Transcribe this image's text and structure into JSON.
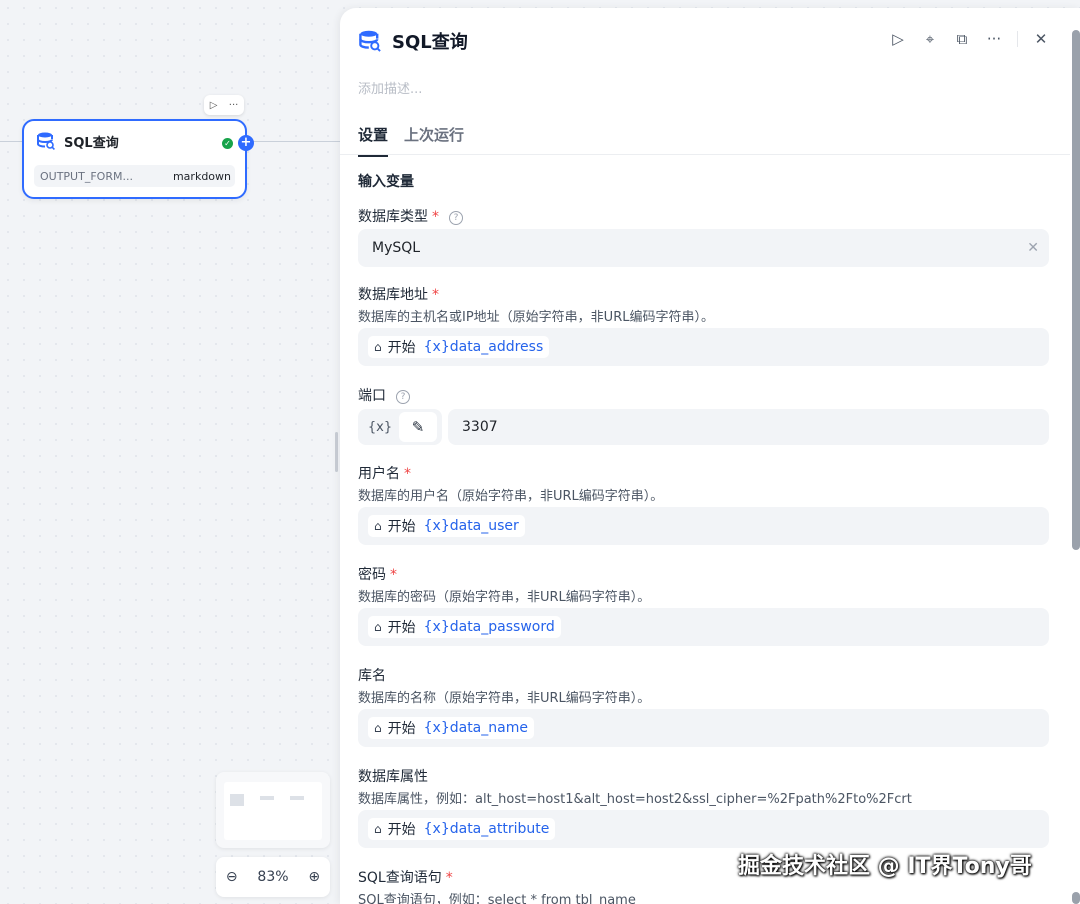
{
  "canvas": {
    "node": {
      "title": "SQL查询",
      "row_key": "OUTPUT_FORM...",
      "row_value": "markdown",
      "toolbar_run": "▷",
      "toolbar_more": "···",
      "status": "✓",
      "add": "+"
    },
    "zoom": {
      "out": "⊖",
      "level": "83%",
      "in": "⊕"
    }
  },
  "panel": {
    "title": "SQL查询",
    "actions": {
      "run": "▷",
      "locate": "⌖",
      "docs": "⧉",
      "more": "···",
      "close": "✕"
    },
    "description_placeholder": "添加描述...",
    "tabs": [
      "设置",
      "上次运行"
    ],
    "section_title": "输入变量",
    "fields": {
      "db_type": {
        "label": "数据库类型",
        "required": "*",
        "help": "?",
        "value": "MySQL",
        "clear": "✕"
      },
      "db_address": {
        "label": "数据库地址",
        "required": "*",
        "hint": "数据库的主机名或IP地址（原始字符串，非URL编码字符串）。",
        "source": "开始",
        "var": "{x}data_address"
      },
      "port": {
        "label": "端口",
        "help": "?",
        "toggle_var": "{x}",
        "toggle_edit": "✎",
        "value": "3307"
      },
      "user": {
        "label": "用户名",
        "required": "*",
        "hint": "数据库的用户名（原始字符串，非URL编码字符串）。",
        "source": "开始",
        "var": "{x}data_user"
      },
      "password": {
        "label": "密码",
        "required": "*",
        "hint": "数据库的密码（原始字符串，非URL编码字符串）。",
        "source": "开始",
        "var": "{x}data_password"
      },
      "db_name": {
        "label": "库名",
        "hint": "数据库的名称（原始字符串，非URL编码字符串）。",
        "source": "开始",
        "var": "{x}data_name"
      },
      "attributes": {
        "label": "数据库属性",
        "hint": "数据库属性，例如：alt_host=host1&alt_host=host2&ssl_cipher=%2Fpath%2Fto%2Fcrt",
        "source": "开始",
        "var": "{x}data_attribute"
      },
      "sql": {
        "label": "SQL查询语句",
        "required": "*",
        "hint": "SQL查询语句，例如：select * from tbl_name"
      }
    }
  },
  "watermark": "掘金技术社区 @ IT界Tony哥"
}
